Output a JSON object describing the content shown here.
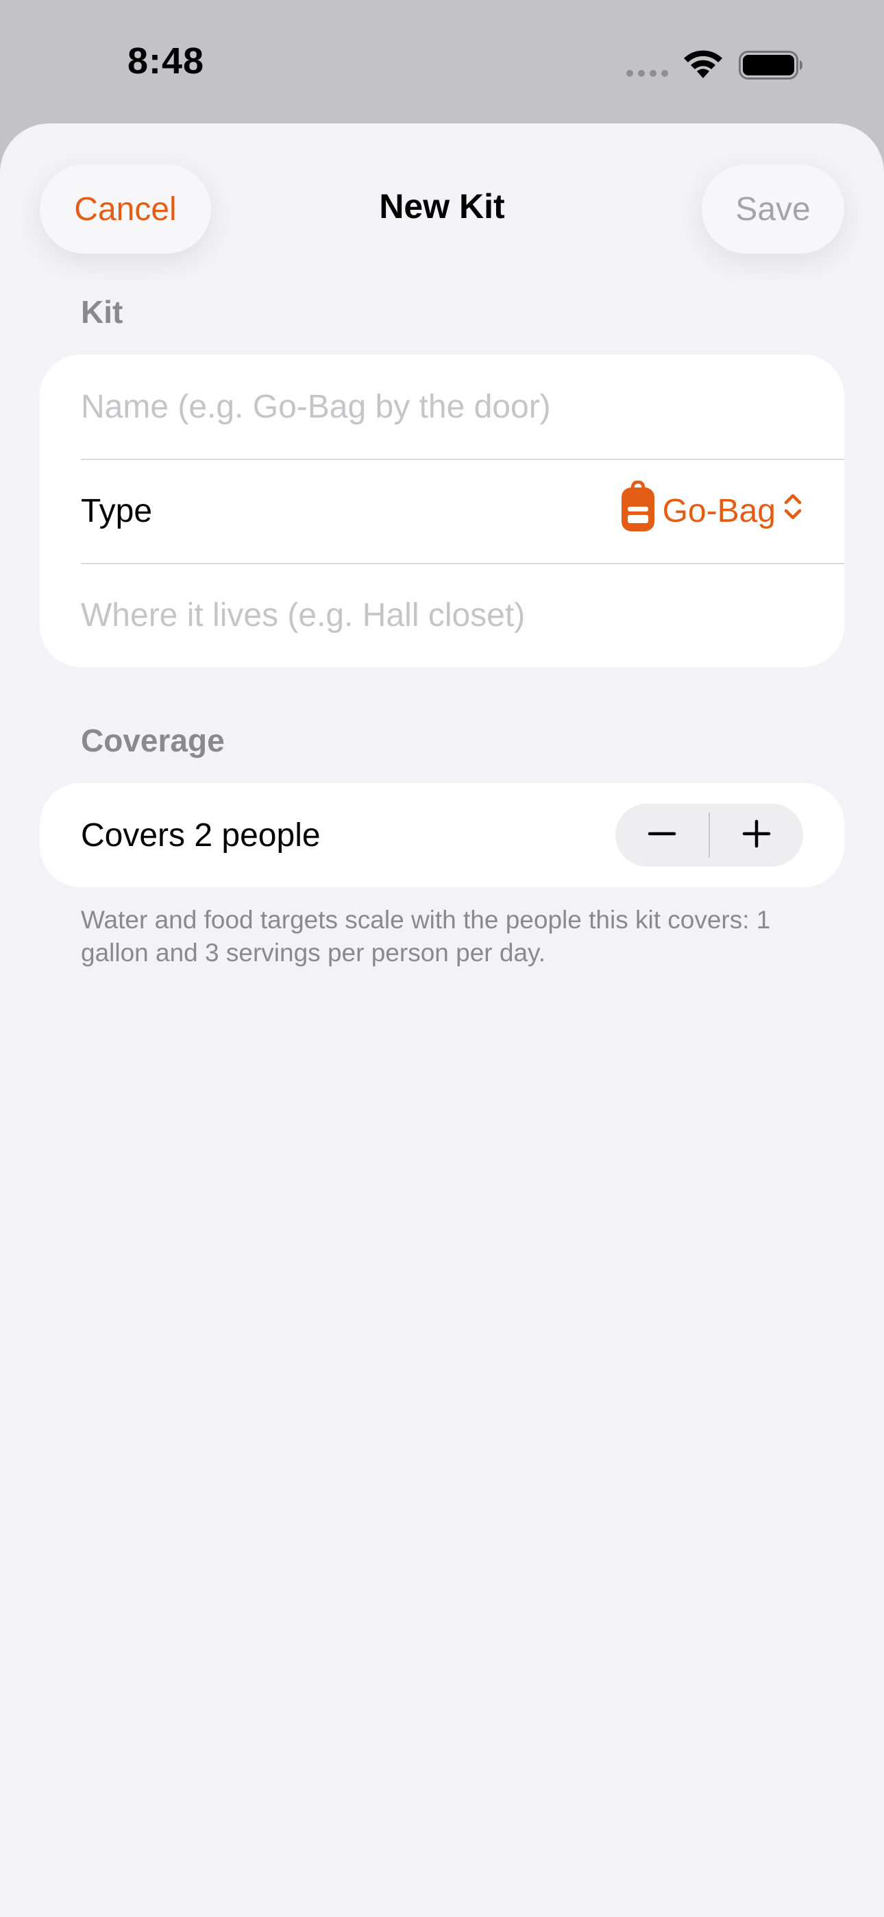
{
  "status_bar": {
    "time": "8:48"
  },
  "nav": {
    "cancel_label": "Cancel",
    "title": "New Kit",
    "save_label": "Save"
  },
  "kit_section": {
    "header": "Kit",
    "name_placeholder": "Name (e.g. Go-Bag by the door)",
    "type_label": "Type",
    "type_value": "Go-Bag",
    "type_icon": "backpack-icon",
    "location_placeholder": "Where it lives (e.g. Hall closet)"
  },
  "coverage_section": {
    "header": "Coverage",
    "covers_label": "Covers 2 people",
    "people_count": 2,
    "footnote": "Water and food targets scale with the people this kit covers: 1 gallon and 3 servings per person per day."
  },
  "colors": {
    "accent": "#e35d15",
    "background": "#f2f2f7",
    "secondary_text": "#8a8a8e",
    "disabled_text": "#a4a4a9"
  }
}
